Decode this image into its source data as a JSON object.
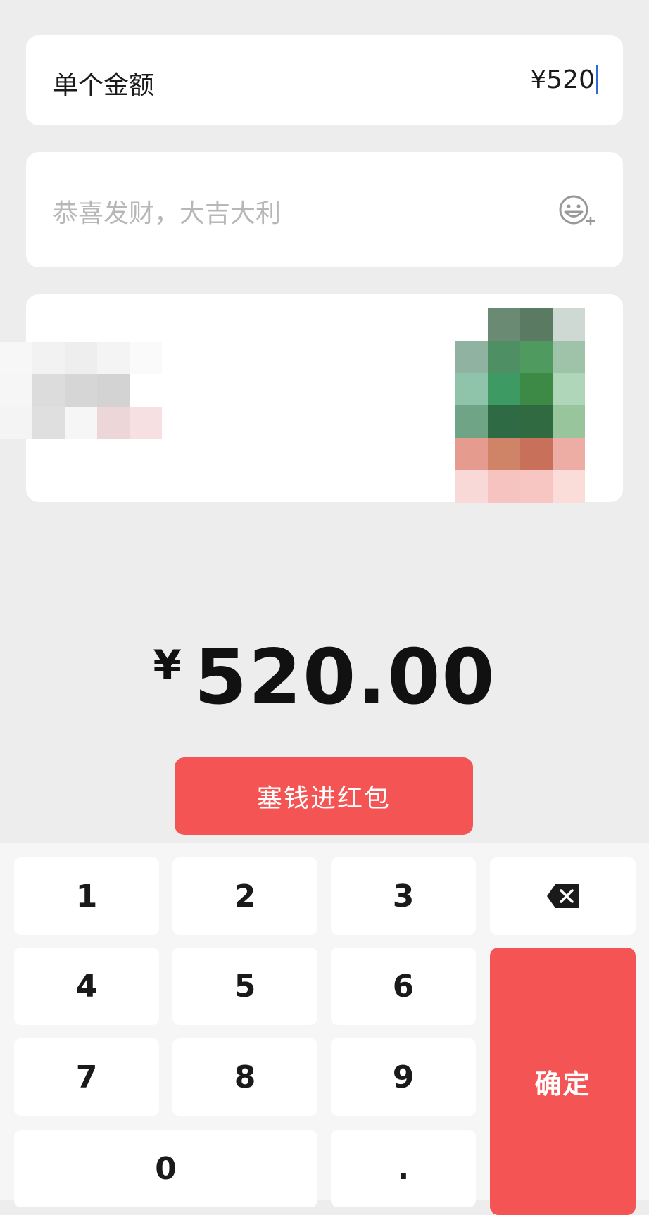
{
  "amount_row": {
    "label": "单个金额",
    "value": "¥520"
  },
  "greeting": {
    "placeholder": "恭喜发财，大吉大利",
    "icon": "emoji-add-icon"
  },
  "cover": {
    "left_pixels": [
      "#f7f7f7",
      "#f2f2f2",
      "#eeeeee",
      "#f4f4f4",
      "#fafafa",
      "#ffffff",
      "#f6f6f6",
      "#dcdcdc",
      "#d6d6d6",
      "#d3d3d3",
      "#ffffff",
      "#ffffff",
      "#f4f4f4",
      "#dfdfdf",
      "#f6f6f6",
      "#ecd6d8",
      "#f6e0e2",
      "#ffffff"
    ],
    "right_pixels": [
      "#ffffff",
      "#6b8a73",
      "#5a7a62",
      "#cfd9d4",
      "#8fb3a0",
      "#4e8f63",
      "#4f9a5e",
      "#9ec3a8",
      "#90c4aa",
      "#3e9a63",
      "#3c8a45",
      "#b0d6ba",
      "#6fa486",
      "#2e6b45",
      "#2f6a40",
      "#98c59c",
      "#e59b8e",
      "#cf8468",
      "#c87059",
      "#eeada4",
      "#f9d9d7",
      "#f6c3c0",
      "#f7c6c2",
      "#fadcd9"
    ]
  },
  "total": {
    "currency": "¥",
    "amount": "520.00"
  },
  "stuff_button": {
    "label": "塞钱进红包"
  },
  "keypad": {
    "keys": [
      "1",
      "2",
      "3",
      "4",
      "5",
      "6",
      "7",
      "8",
      "9",
      "0",
      "."
    ],
    "confirm": "确定",
    "backspace_icon": "backspace-icon"
  },
  "colors": {
    "accent": "#f55454",
    "background": "#ededed",
    "caret": "#2f6bd8"
  }
}
